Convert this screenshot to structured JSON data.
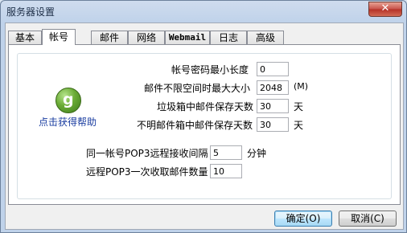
{
  "window": {
    "title": "服务器设置",
    "close_symbol": "✕"
  },
  "tabs": [
    {
      "label": "基本"
    },
    {
      "label": "帐号"
    },
    {
      "label": "邮件"
    },
    {
      "label": "网络"
    },
    {
      "label": "Webmail"
    },
    {
      "label": "日志"
    },
    {
      "label": "高级"
    }
  ],
  "active_tab": "帐号",
  "help": {
    "icon": "help-icon",
    "link_label": "点击获得帮助"
  },
  "fields": {
    "min_pwd_len": {
      "label": "帐号密码最小长度",
      "value": "0"
    },
    "mailbox_max": {
      "label": "邮件不限空间时最大大小",
      "value": "2048",
      "unit": "(M)"
    },
    "junk_days": {
      "label": "垃圾箱中邮件保存天数",
      "value": "30",
      "unit": "天"
    },
    "unknown_days": {
      "label": "不明邮件箱中邮件保存天数",
      "value": "30",
      "unit": "天"
    },
    "pop3_interval": {
      "label": "同一帐号POP3远程接收间隔",
      "value": "5",
      "unit": "分钟"
    },
    "pop3_count": {
      "label": "远程POP3一次收取邮件数量",
      "value": "10"
    }
  },
  "buttons": {
    "ok": "确定(O)",
    "cancel": "取消(C)"
  }
}
